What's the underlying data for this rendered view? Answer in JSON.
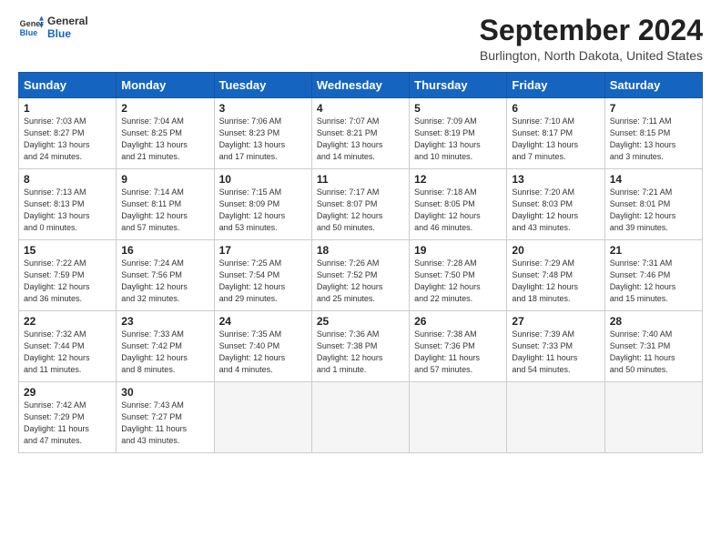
{
  "logo": {
    "line1": "General",
    "line2": "Blue"
  },
  "title": "September 2024",
  "location": "Burlington, North Dakota, United States",
  "days_of_week": [
    "Sunday",
    "Monday",
    "Tuesday",
    "Wednesday",
    "Thursday",
    "Friday",
    "Saturday"
  ],
  "weeks": [
    [
      {
        "day": "1",
        "info": "Sunrise: 7:03 AM\nSunset: 8:27 PM\nDaylight: 13 hours\nand 24 minutes."
      },
      {
        "day": "2",
        "info": "Sunrise: 7:04 AM\nSunset: 8:25 PM\nDaylight: 13 hours\nand 21 minutes."
      },
      {
        "day": "3",
        "info": "Sunrise: 7:06 AM\nSunset: 8:23 PM\nDaylight: 13 hours\nand 17 minutes."
      },
      {
        "day": "4",
        "info": "Sunrise: 7:07 AM\nSunset: 8:21 PM\nDaylight: 13 hours\nand 14 minutes."
      },
      {
        "day": "5",
        "info": "Sunrise: 7:09 AM\nSunset: 8:19 PM\nDaylight: 13 hours\nand 10 minutes."
      },
      {
        "day": "6",
        "info": "Sunrise: 7:10 AM\nSunset: 8:17 PM\nDaylight: 13 hours\nand 7 minutes."
      },
      {
        "day": "7",
        "info": "Sunrise: 7:11 AM\nSunset: 8:15 PM\nDaylight: 13 hours\nand 3 minutes."
      }
    ],
    [
      {
        "day": "8",
        "info": "Sunrise: 7:13 AM\nSunset: 8:13 PM\nDaylight: 13 hours\nand 0 minutes."
      },
      {
        "day": "9",
        "info": "Sunrise: 7:14 AM\nSunset: 8:11 PM\nDaylight: 12 hours\nand 57 minutes."
      },
      {
        "day": "10",
        "info": "Sunrise: 7:15 AM\nSunset: 8:09 PM\nDaylight: 12 hours\nand 53 minutes."
      },
      {
        "day": "11",
        "info": "Sunrise: 7:17 AM\nSunset: 8:07 PM\nDaylight: 12 hours\nand 50 minutes."
      },
      {
        "day": "12",
        "info": "Sunrise: 7:18 AM\nSunset: 8:05 PM\nDaylight: 12 hours\nand 46 minutes."
      },
      {
        "day": "13",
        "info": "Sunrise: 7:20 AM\nSunset: 8:03 PM\nDaylight: 12 hours\nand 43 minutes."
      },
      {
        "day": "14",
        "info": "Sunrise: 7:21 AM\nSunset: 8:01 PM\nDaylight: 12 hours\nand 39 minutes."
      }
    ],
    [
      {
        "day": "15",
        "info": "Sunrise: 7:22 AM\nSunset: 7:59 PM\nDaylight: 12 hours\nand 36 minutes."
      },
      {
        "day": "16",
        "info": "Sunrise: 7:24 AM\nSunset: 7:56 PM\nDaylight: 12 hours\nand 32 minutes."
      },
      {
        "day": "17",
        "info": "Sunrise: 7:25 AM\nSunset: 7:54 PM\nDaylight: 12 hours\nand 29 minutes."
      },
      {
        "day": "18",
        "info": "Sunrise: 7:26 AM\nSunset: 7:52 PM\nDaylight: 12 hours\nand 25 minutes."
      },
      {
        "day": "19",
        "info": "Sunrise: 7:28 AM\nSunset: 7:50 PM\nDaylight: 12 hours\nand 22 minutes."
      },
      {
        "day": "20",
        "info": "Sunrise: 7:29 AM\nSunset: 7:48 PM\nDaylight: 12 hours\nand 18 minutes."
      },
      {
        "day": "21",
        "info": "Sunrise: 7:31 AM\nSunset: 7:46 PM\nDaylight: 12 hours\nand 15 minutes."
      }
    ],
    [
      {
        "day": "22",
        "info": "Sunrise: 7:32 AM\nSunset: 7:44 PM\nDaylight: 12 hours\nand 11 minutes."
      },
      {
        "day": "23",
        "info": "Sunrise: 7:33 AM\nSunset: 7:42 PM\nDaylight: 12 hours\nand 8 minutes."
      },
      {
        "day": "24",
        "info": "Sunrise: 7:35 AM\nSunset: 7:40 PM\nDaylight: 12 hours\nand 4 minutes."
      },
      {
        "day": "25",
        "info": "Sunrise: 7:36 AM\nSunset: 7:38 PM\nDaylight: 12 hours\nand 1 minute."
      },
      {
        "day": "26",
        "info": "Sunrise: 7:38 AM\nSunset: 7:36 PM\nDaylight: 11 hours\nand 57 minutes."
      },
      {
        "day": "27",
        "info": "Sunrise: 7:39 AM\nSunset: 7:33 PM\nDaylight: 11 hours\nand 54 minutes."
      },
      {
        "day": "28",
        "info": "Sunrise: 7:40 AM\nSunset: 7:31 PM\nDaylight: 11 hours\nand 50 minutes."
      }
    ],
    [
      {
        "day": "29",
        "info": "Sunrise: 7:42 AM\nSunset: 7:29 PM\nDaylight: 11 hours\nand 47 minutes."
      },
      {
        "day": "30",
        "info": "Sunrise: 7:43 AM\nSunset: 7:27 PM\nDaylight: 11 hours\nand 43 minutes."
      },
      {
        "day": "",
        "info": ""
      },
      {
        "day": "",
        "info": ""
      },
      {
        "day": "",
        "info": ""
      },
      {
        "day": "",
        "info": ""
      },
      {
        "day": "",
        "info": ""
      }
    ]
  ]
}
